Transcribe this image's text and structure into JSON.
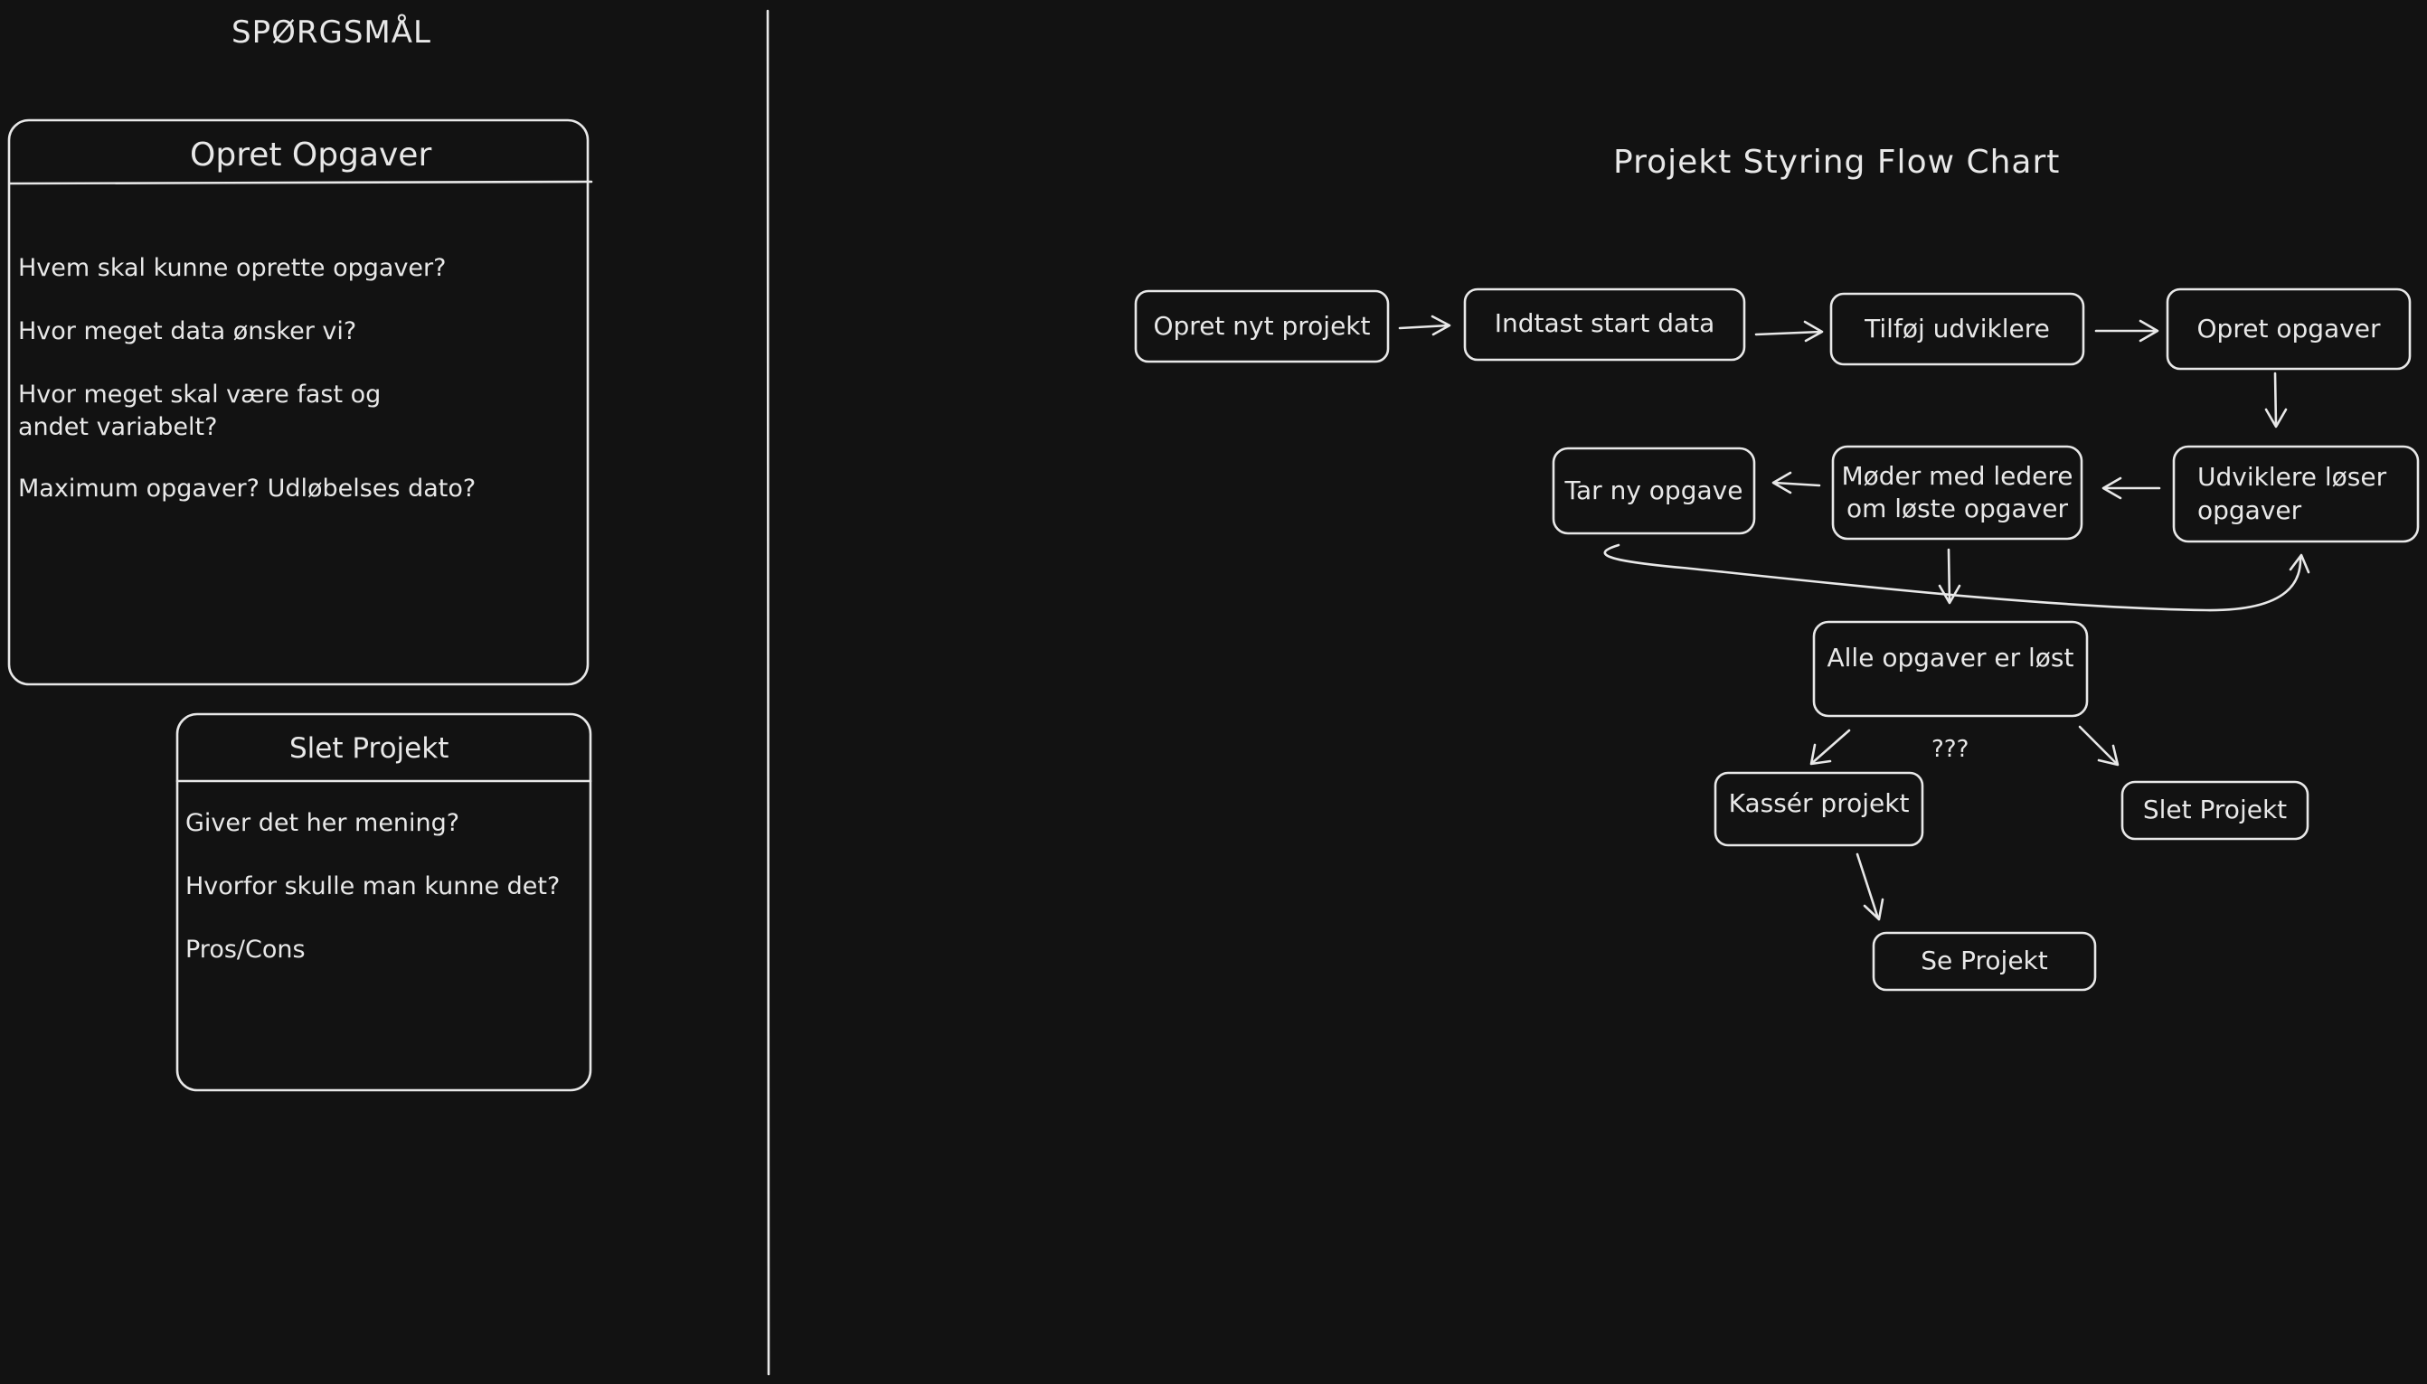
{
  "colors": {
    "background": "#121212",
    "stroke": "#e8e8e8",
    "text": "#e8e8e8"
  },
  "questions_panel": {
    "heading": "SPØRGSMÅL",
    "card_opret": {
      "title": "Opret Opgaver",
      "items": [
        "Hvem skal kunne oprette opgaver?",
        "Hvor meget data ønsker vi?",
        "Hvor meget skal være fast og\nandet variabelt?",
        "Maximum opgaver? Udløbelses dato?"
      ]
    },
    "card_slet": {
      "title": "Slet Projekt",
      "items": [
        "Giver det her mening?",
        "Hvorfor skulle man kunne det?",
        "Pros/Cons"
      ]
    }
  },
  "flowchart": {
    "title": "Projekt Styring Flow Chart",
    "nodes": {
      "opret_nyt_projekt": "Opret nyt projekt",
      "indtast_start_data": "Indtast start data",
      "tilfoej_udviklere": "Tilføj udviklere",
      "opret_opgaver": "Opret opgaver",
      "udviklere_loeser": "Udviklere løser\nopgaver",
      "moeder_med_ledere": "Møder med ledere\nom løste opgaver",
      "tar_ny_opgave": "Tar ny opgave",
      "alle_opgaver_loest": "Alle opgaver er løst",
      "kasser_projekt": "Kassér projekt",
      "slet_projekt": "Slet Projekt",
      "se_projekt": "Se Projekt"
    },
    "decision_label": "???"
  }
}
